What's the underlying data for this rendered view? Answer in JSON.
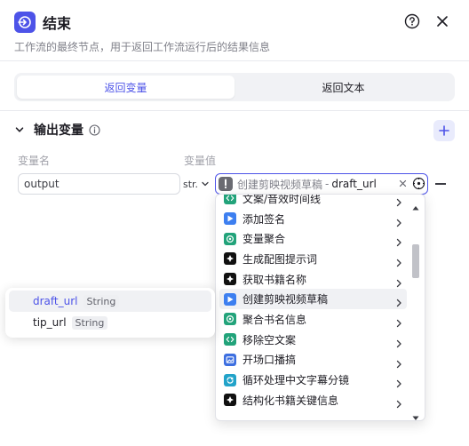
{
  "header": {
    "title": "结束",
    "description": "工作流的最终节点，用于返回工作流运行后的结果信息"
  },
  "mode_tabs": [
    {
      "label": "返回变量",
      "active": true
    },
    {
      "label": "返回文本",
      "active": false
    }
  ],
  "output_section": {
    "title": "输出变量",
    "column_name": "变量名",
    "column_value": "变量值"
  },
  "row": {
    "name": "output",
    "type": "str.",
    "ref_node": "创建剪映视频草稿",
    "ref_separator": "-",
    "ref_var": "draft_url"
  },
  "node_list": [
    {
      "label": "文案/音效时间线",
      "icon": "code-icon",
      "color": "#22a37a"
    },
    {
      "label": "添加签名",
      "icon": "play-icon",
      "color": "#3d7ff0"
    },
    {
      "label": "变量聚合",
      "icon": "aggregate-icon",
      "color": "#22a37a"
    },
    {
      "label": "生成配图提示词",
      "icon": "llm-icon",
      "color": "#111111"
    },
    {
      "label": "获取书籍名称",
      "icon": "llm-icon",
      "color": "#111111"
    },
    {
      "label": "创建剪映视频草稿",
      "icon": "play-icon",
      "color": "#3d7ff0",
      "highlighted": true
    },
    {
      "label": "聚合书名信息",
      "icon": "aggregate-icon",
      "color": "#22a37a"
    },
    {
      "label": "移除空文案",
      "icon": "code-icon",
      "color": "#22a37a"
    },
    {
      "label": "开场口播搞",
      "icon": "image-icon",
      "color": "#3d6fe0"
    },
    {
      "label": "循环处理中文字幕分镜",
      "icon": "loop-icon",
      "color": "#22a3c9"
    },
    {
      "label": "结构化书籍关键信息",
      "icon": "llm-icon",
      "color": "#111111"
    }
  ],
  "variables_popover": [
    {
      "name": "draft_url",
      "type": "String",
      "highlighted": true
    },
    {
      "name": "tip_url",
      "type": "String",
      "highlighted": false
    }
  ],
  "colors": {
    "accent": "#4d53e8",
    "border": "#e1e2e7",
    "muted_text": "#80818a"
  }
}
